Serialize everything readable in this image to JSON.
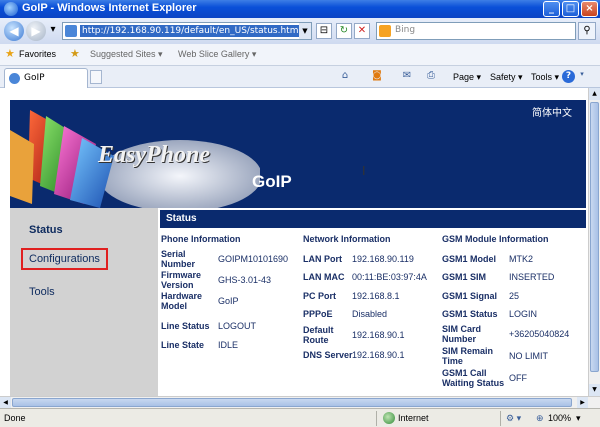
{
  "window": {
    "title": "GoIP - Windows Internet Explorer"
  },
  "address": {
    "url": "http://192.168.90.119/default/en_US/status.html",
    "search_placeholder": "Bing"
  },
  "favorites": {
    "label": "Favorites",
    "items": [
      "Suggested Sites ▾",
      "Web Slice Gallery ▾"
    ]
  },
  "tab": {
    "label": "GoIP"
  },
  "commands": {
    "page": "Page ▾",
    "safety": "Safety ▾",
    "tools": "Tools ▾"
  },
  "header": {
    "brand": "EasyPhone",
    "product": "GoIP",
    "language": "简体中文"
  },
  "nav": [
    "Status",
    "Configurations",
    "Tools"
  ],
  "panel": {
    "title": "Status",
    "columns": [
      {
        "heading": "Phone Information",
        "rows": [
          {
            "label": "Serial Number",
            "value": "GOIPM10101690"
          },
          {
            "label": "Firmware Version",
            "value": "GHS-3.01-43"
          },
          {
            "label": "Hardware Model",
            "value": "GoIP"
          },
          {
            "label": "Line Status",
            "value": "LOGOUT"
          },
          {
            "label": "Line State",
            "value": "IDLE"
          }
        ]
      },
      {
        "heading": "Network Information",
        "rows": [
          {
            "label": "LAN Port",
            "value": "192.168.90.119"
          },
          {
            "label": "LAN MAC",
            "value": "00:11:BE:03:97:4A"
          },
          {
            "label": "PC Port",
            "value": "192.168.8.1"
          },
          {
            "label": "PPPoE",
            "value": "Disabled"
          },
          {
            "label": "Default Route",
            "value": "192.168.90.1"
          },
          {
            "label": "DNS Server",
            "value": "192.168.90.1"
          }
        ]
      },
      {
        "heading": "GSM Module Information",
        "rows": [
          {
            "label": "GSM1 Model",
            "value": "MTK2"
          },
          {
            "label": "GSM1 SIM",
            "value": "INSERTED"
          },
          {
            "label": "GSM1 Signal",
            "value": "25"
          },
          {
            "label": "GSM1 Status",
            "value": "LOGIN"
          },
          {
            "label": "SIM Card Number",
            "value": "+36205040824"
          },
          {
            "label": "SIM Remain Time",
            "value": "NO LIMIT"
          },
          {
            "label": "GSM1 Call Waiting Status",
            "value": "OFF"
          }
        ]
      }
    ]
  },
  "statusbar": {
    "text": "Done",
    "zone": "Internet",
    "zoom": "100%"
  },
  "colors": {
    "title_bar": "#0b45c4",
    "header_bg": "#0a2a6e",
    "sidebar_bg": "#d2d2d2",
    "highlight_box": "#e02020"
  }
}
